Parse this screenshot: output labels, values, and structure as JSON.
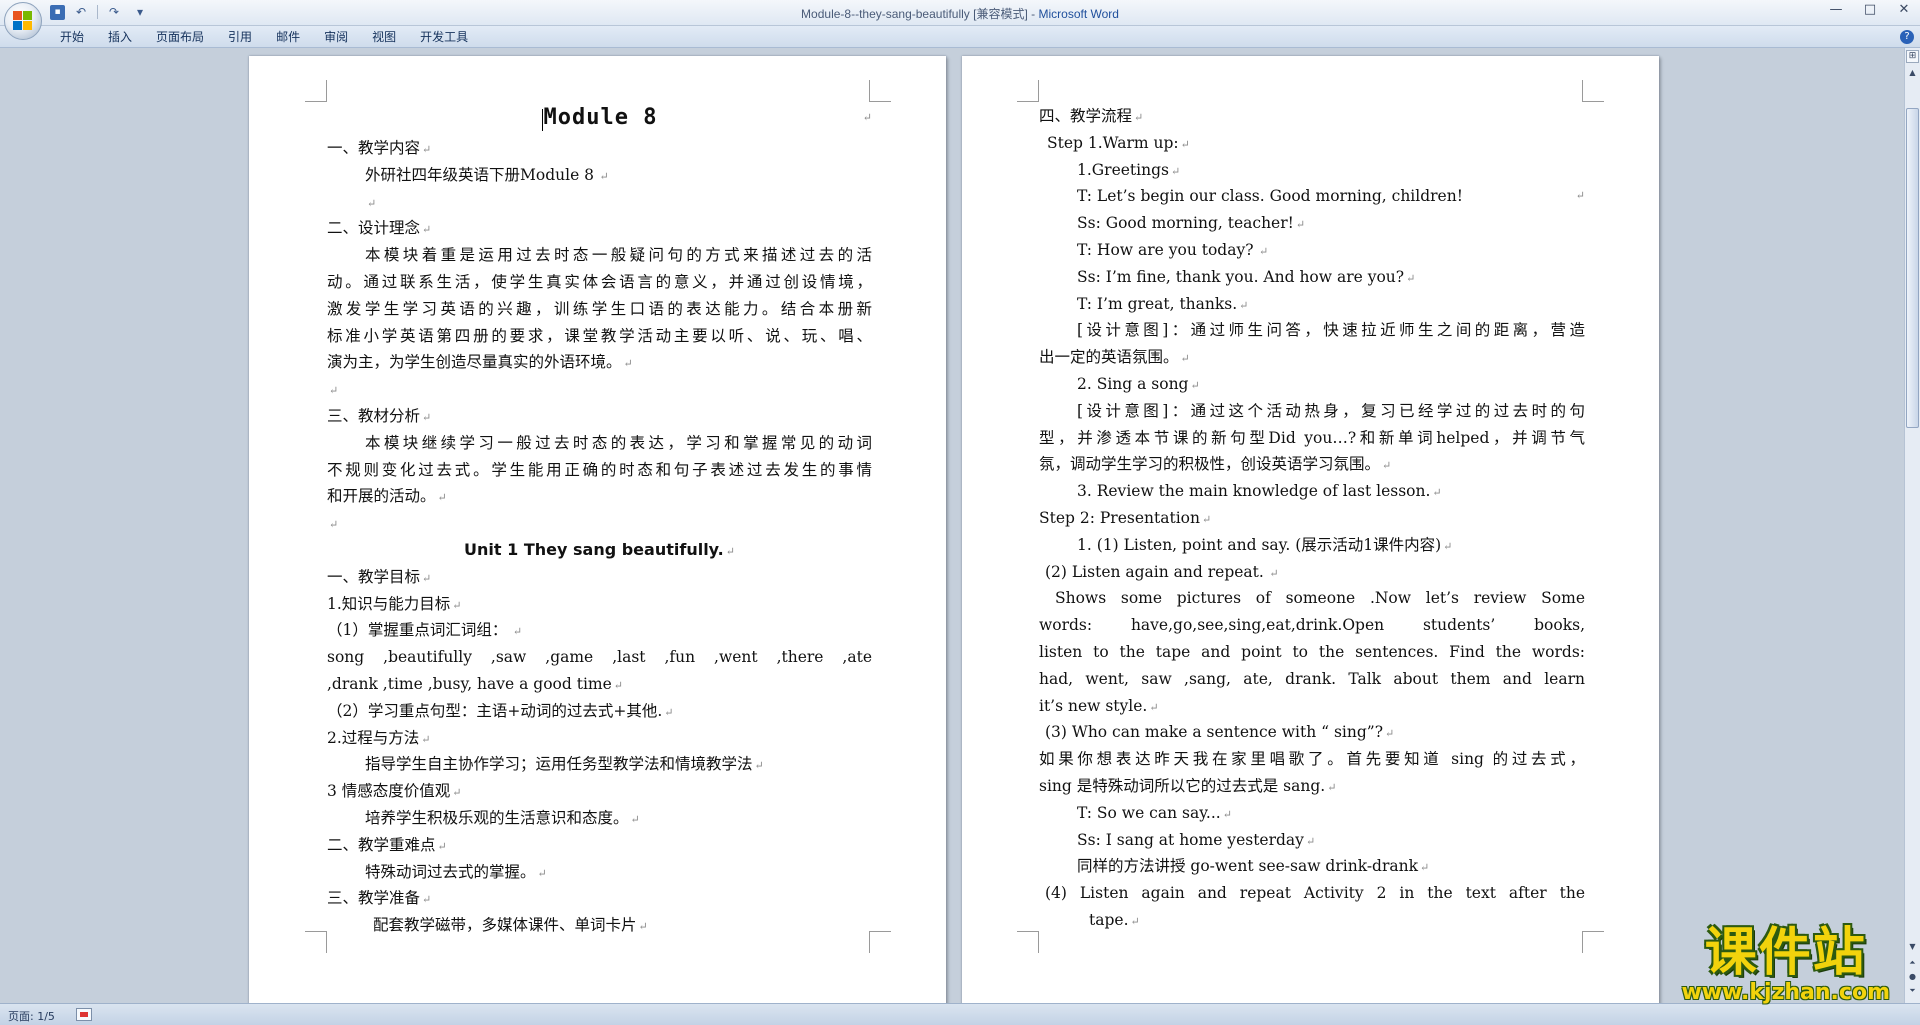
{
  "window": {
    "title_doc": "Module-8--they-sang-beautifully [兼容模式]",
    "title_sep": " - ",
    "title_app": "Microsoft Word",
    "controls": [
      "—",
      "□",
      "✕"
    ]
  },
  "qat": {
    "save": "▪",
    "undo": "↶",
    "redo": "↷",
    "more": "▾"
  },
  "ribbon": {
    "tabs": [
      "开始",
      "插入",
      "页面布局",
      "引用",
      "邮件",
      "审阅",
      "视图",
      "开发工具"
    ],
    "help": "?"
  },
  "status": {
    "page": "页面: 1/5"
  },
  "watermark": {
    "cn": "课件站",
    "en": "www.kjzhan.com"
  },
  "page1": [
    "Module 8",
    "一、教学内容",
    "外研社四年级英语下册Module 8",
    "",
    "二、设计理念",
    "本模块着重是运用过去时态一般疑问句的方式来描述过去的活",
    "动。通过联系生活，使学生真实体会语言的意义，并通过创设情境，",
    "激发学生学习英语的兴趣，训练学生口语的表达能力。结合本册新",
    "标准小学英语第四册的要求，课堂教学活动主要以听、说、玩、唱、",
    "演为主，为学生创造尽量真实的外语环境。",
    "",
    "三、教材分析",
    "本模块继续学习一般过去时态的表达，学习和掌握常见的动词",
    "不规则变化过去式。学生能用正确的时态和句子表述过去发生的事情",
    "和开展的活动。",
    "",
    "Unit 1 They sang beautifully.",
    "一、教学目标",
    "1.知识与能力目标",
    "（1）掌握重点词汇词组：",
    "song ,beautifully ,saw ,game ,last ,fun ,went ,there ,ate",
    ",drank ,time ,busy, have a good time",
    "（2）学习重点句型：主语+动词的过去式+其他.",
    "2.过程与方法",
    "指导学生自主协作学习；运用任务型教学法和情境教学法",
    "3 情感态度价值观",
    "培养学生积极乐观的生活意识和态度。",
    "二、教学重难点",
    "特殊动词过去式的掌握。",
    "三、教学准备",
    "配套教学磁带，多媒体课件、单词卡片"
  ],
  "page2": [
    "四、教学流程",
    "Step 1.Warm up:",
    "1.Greetings",
    "T:  Let’s begin our class. Good morning, children!",
    "Ss: Good morning, teacher!",
    "T: How are you today?",
    "Ss: I’m fine, thank you. And how are you?",
    "T: I’m great, thanks.",
    "[设计意图]：通过师生问答，快速拉近师生之间的距离，营造",
    "出一定的英语氛围。",
    "2. Sing a song",
    "[设计意图]：通过这个活动热身，复习已经学过的过去时的句",
    "型，并渗透本节课的新句型Did you…?和新单词helped，并调节气",
    "氛，调动学生学习的积极性，创设英语学习氛围。",
    "3. Review the main knowledge of last lesson.",
    "Step 2: Presentation",
    "1. (1) Listen, point and say. (展示活动1课件内容)",
    "(2) Listen again and repeat.",
    "Shows some pictures of someone .Now let’s review Some",
    "words: have,go,see,sing,eat,drink.Open students’ books,",
    "listen to the tape and point to the sentences. Find the words:",
    "had, went, saw ,sang, ate, drank. Talk about them and learn",
    "it’s new style.",
    "(3) Who can make a sentence with “ sing”?",
    "如果你想表达昨天我在家里唱歌了。首先要知道 sing 的过去式，",
    "sing 是特殊动词所以它的过去式是 sang.",
    "T: So we can say...",
    "Ss: I sang at home yesterday",
    "同样的方法讲授 go-went   see-saw  drink-drank",
    "(4) Listen again and repeat Activity 2 in the text after the",
    "tape."
  ]
}
